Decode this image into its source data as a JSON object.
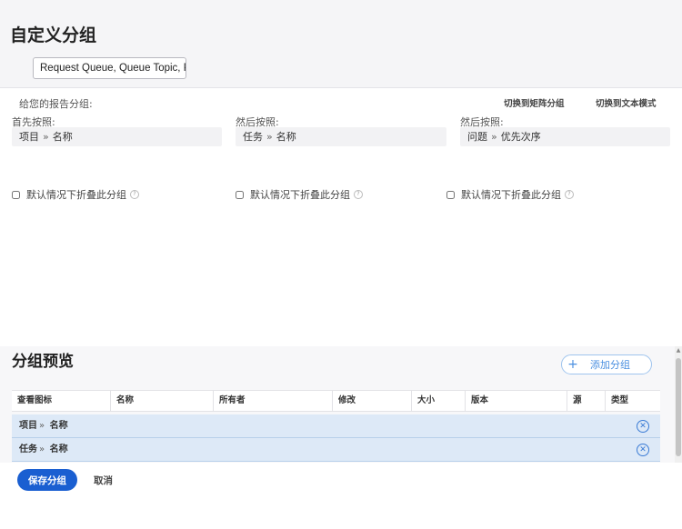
{
  "page_title": "自定义分组",
  "name_field": {
    "value": "Request Queue, Queue Topic, Pr"
  },
  "config": {
    "give_label": "给您的报告分组:",
    "switch_matrix": "切换到矩阵分组",
    "switch_text": "切换到文本模式",
    "groups": [
      {
        "label": "首先按照:",
        "object": "项目",
        "field": "名称"
      },
      {
        "label": "然后按照:",
        "object": "任务",
        "field": "名称"
      },
      {
        "label": "然后按照:",
        "object": "问题",
        "field": "优先次序"
      }
    ],
    "chevron": "»",
    "collapse_label": "默认情况下折叠此分组",
    "help_glyph": "?"
  },
  "preview": {
    "title": "分组预览",
    "add_group": "添加分组",
    "columns": [
      "查看图标",
      "名称",
      "所有者",
      "修改",
      "大小",
      "版本",
      "源",
      "类型"
    ],
    "rows": [
      {
        "object": "项目",
        "field": "名称"
      },
      {
        "object": "任务",
        "field": "名称"
      }
    ]
  },
  "footer": {
    "save": "保存分组",
    "cancel": "取消"
  },
  "colors": {
    "primary": "#1a5fd1",
    "row_highlight": "#dde9f7",
    "accent_border": "#9fc4ee"
  }
}
